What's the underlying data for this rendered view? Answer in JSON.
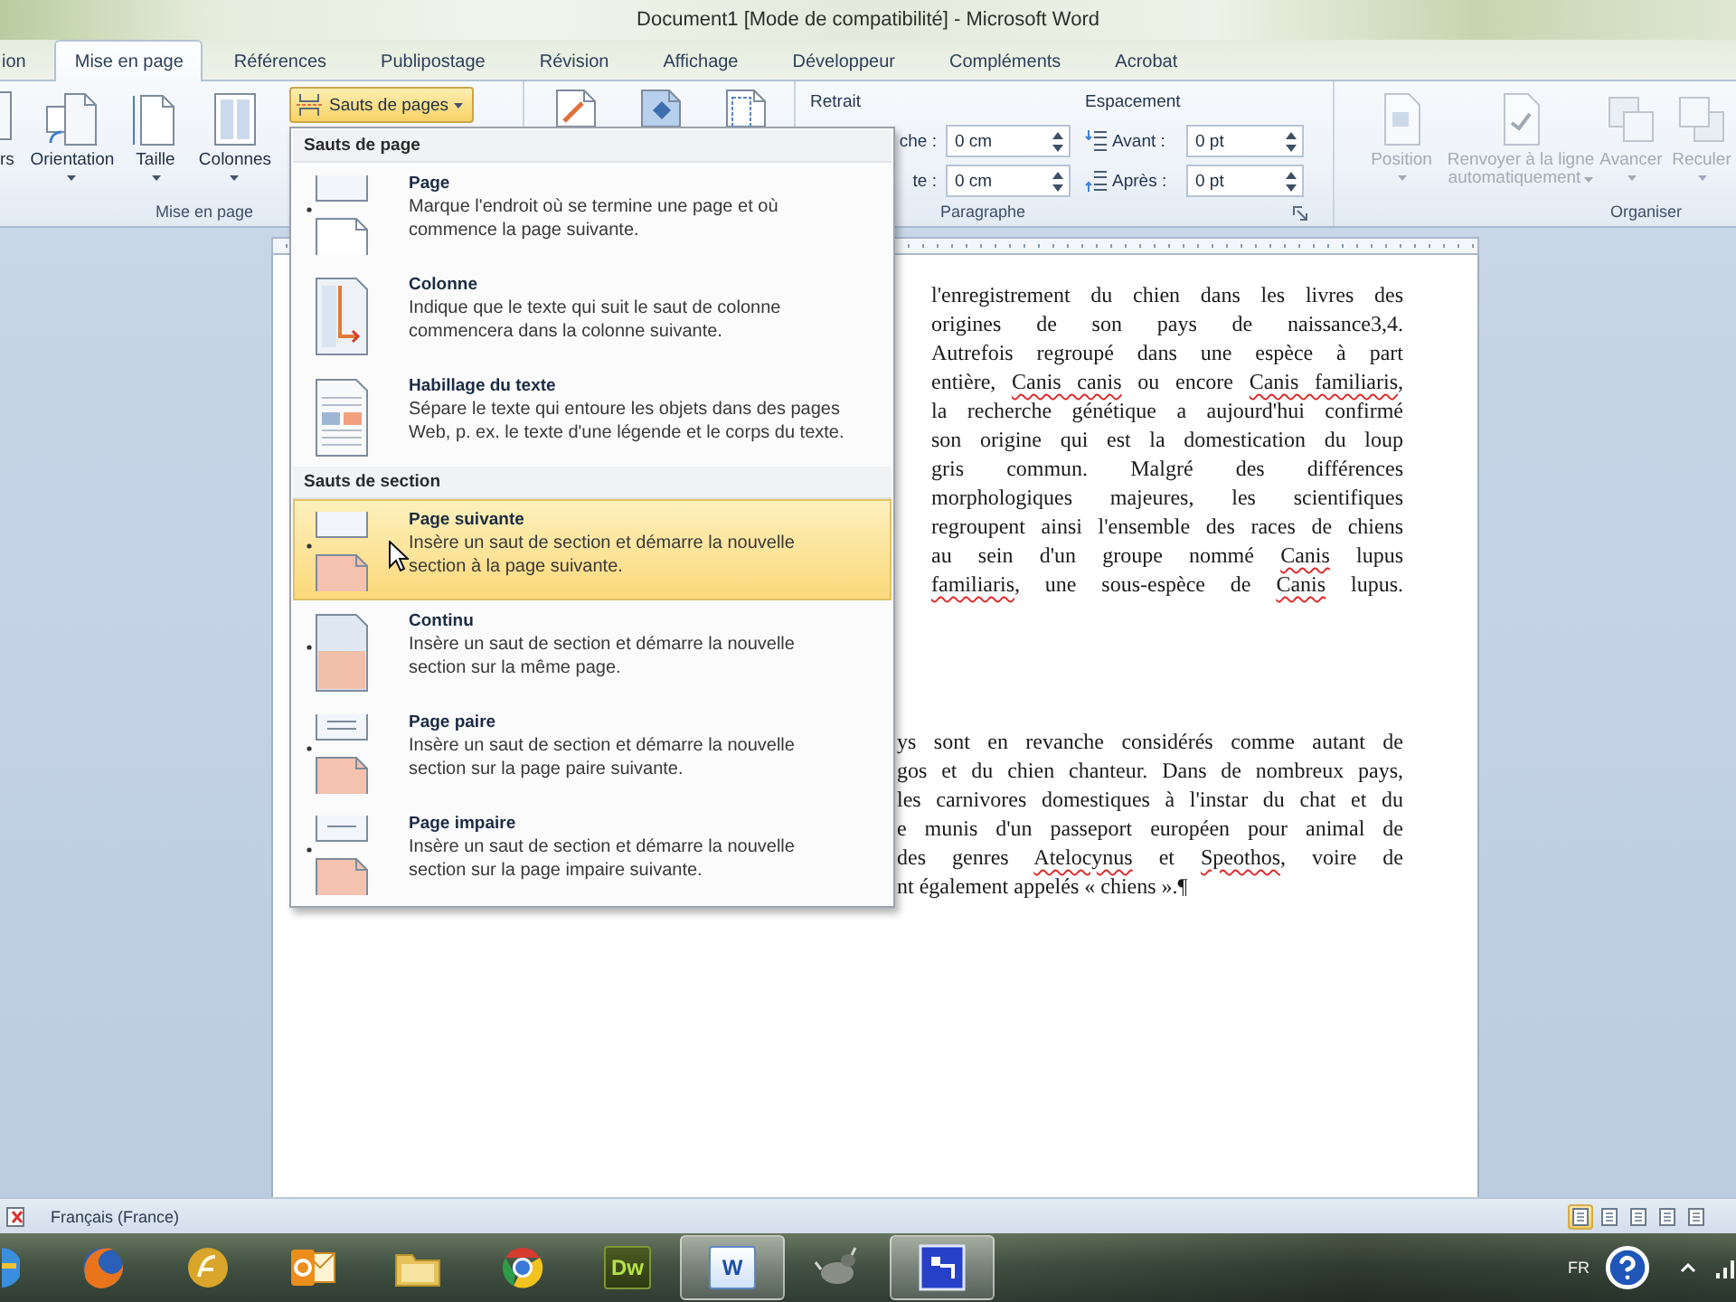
{
  "window": {
    "title": "Document1 [Mode de compatibilité] - Microsoft Word"
  },
  "tabs": [
    {
      "label": "ion",
      "selected": false
    },
    {
      "label": "Mise en page",
      "selected": true
    },
    {
      "label": "Références",
      "selected": false
    },
    {
      "label": "Publipostage",
      "selected": false
    },
    {
      "label": "Révision",
      "selected": false
    },
    {
      "label": "Affichage",
      "selected": false
    },
    {
      "label": "Développeur",
      "selected": false
    },
    {
      "label": "Compléments",
      "selected": false
    },
    {
      "label": "Acrobat",
      "selected": false
    }
  ],
  "ribbon": {
    "page_setup": {
      "label": "Mise en page",
      "buttons": [
        {
          "kind": "margins",
          "label": "rs",
          "dropdown": false,
          "disabled": false
        },
        {
          "kind": "orientation",
          "label": "Orientation",
          "dropdown": true,
          "disabled": false
        },
        {
          "kind": "size",
          "label": "Taille",
          "dropdown": true,
          "disabled": false
        },
        {
          "kind": "columns",
          "label": "Colonnes",
          "dropdown": true,
          "disabled": false
        }
      ],
      "breaks_button": {
        "label": "Sauts de pages",
        "expanded": true
      }
    },
    "page_background": {
      "buttons": [
        {
          "kind": "watermark"
        },
        {
          "kind": "page-color"
        },
        {
          "kind": "page-borders"
        }
      ]
    },
    "paragraph": {
      "label": "Paragraphe",
      "indent": {
        "title": "Retrait",
        "fields": [
          {
            "label": "che :",
            "value": "0 cm"
          },
          {
            "label": "te :",
            "value": "0 cm"
          }
        ]
      },
      "spacing": {
        "title": "Espacement",
        "fields": [
          {
            "kind": "before",
            "label": "Avant :",
            "value": "0 pt"
          },
          {
            "kind": "after",
            "label": "Après :",
            "value": "0 pt"
          }
        ]
      }
    },
    "arrange": {
      "label": "Organiser",
      "buttons": [
        {
          "kind": "position",
          "label": "Position",
          "dropdown": true,
          "disabled": true
        },
        {
          "kind": "wrap-text",
          "label": "Renvoyer à la ligne\nautomatiquement",
          "dropdown": true,
          "disabled": true
        },
        {
          "kind": "bring-forward",
          "label": "Avancer",
          "dropdown": true,
          "disabled": true
        },
        {
          "kind": "send-backward",
          "label": "Reculer",
          "dropdown": true,
          "disabled": true
        }
      ]
    }
  },
  "breaks_menu": {
    "sections": [
      {
        "title": "Sauts de page",
        "items": [
          {
            "kind": "page",
            "title": "Page",
            "description": "Marque l'endroit où se termine une page et où\ncommence la page suivante.",
            "highlighted": false
          },
          {
            "kind": "column",
            "title": "Colonne",
            "description": "Indique que le texte qui suit le saut de colonne\ncommencera dans la colonne suivante.",
            "highlighted": false
          },
          {
            "kind": "wrap",
            "title": "Habillage du texte",
            "description": "Sépare le texte qui entoure les objets dans des pages\nWeb, p. ex. le texte d'une légende et le corps du texte.",
            "highlighted": false
          }
        ]
      },
      {
        "title": "Sauts de section",
        "items": [
          {
            "kind": "next",
            "title": "Page suivante",
            "description": "Insère un saut de section et démarre la nouvelle\nsection à la page suivante.",
            "highlighted": true
          },
          {
            "kind": "continuous",
            "title": "Continu",
            "description": "Insère un saut de section et démarre la nouvelle\nsection sur la même page.",
            "highlighted": false
          },
          {
            "kind": "even",
            "title": "Page paire",
            "description": "Insère un saut de section et démarre la nouvelle\nsection sur la page paire suivante.",
            "highlighted": false
          },
          {
            "kind": "odd",
            "title": "Page impaire",
            "description": "Insère un saut de section et démarre la nouvelle\nsection sur la page impaire suivante.",
            "highlighted": false
          }
        ]
      }
    ]
  },
  "document": {
    "paragraphs": [
      {
        "last_line_justified": true,
        "lines": [
          [
            {
              "text": "l'enregistrement du chien dans les livres des",
              "misspelled": false
            }
          ],
          [
            {
              "text": "origines de son pays de naissance3,4.",
              "misspelled": false
            }
          ],
          [
            {
              "text": "Autrefois regroupé dans une espèce à part",
              "misspelled": false
            }
          ],
          [
            {
              "text": "entière, ",
              "misspelled": false
            },
            {
              "text": "Canis canis",
              "misspelled": true
            },
            {
              "text": " ou encore ",
              "misspelled": false
            },
            {
              "text": "Canis familiaris",
              "misspelled": true
            },
            {
              "text": ",",
              "misspelled": false
            }
          ],
          [
            {
              "text": "la recherche génétique a aujourd'hui confirmé",
              "misspelled": false
            }
          ],
          [
            {
              "text": "son origine qui est la domestication du loup",
              "misspelled": false
            }
          ],
          [
            {
              "text": "gris commun. Malgré des différences",
              "misspelled": false
            }
          ],
          [
            {
              "text": "morphologiques majeures, les scientifiques",
              "misspelled": false
            }
          ],
          [
            {
              "text": "regroupent ainsi l'ensemble des races de chiens",
              "misspelled": false
            }
          ],
          [
            {
              "text": "au sein d'un groupe nommé ",
              "misspelled": false
            },
            {
              "text": "Canis",
              "misspelled": true
            },
            {
              "text": " lupus",
              "misspelled": false
            }
          ],
          [
            {
              "text": "familiaris",
              "misspelled": true
            },
            {
              "text": ", une sous-espèce de ",
              "misspelled": false
            },
            {
              "text": "Canis",
              "misspelled": true
            },
            {
              "text": " lupus.",
              "misspelled": false
            }
          ]
        ]
      },
      {
        "last_line_justified": false,
        "lines": [
          [
            {
              "text": "ys sont en revanche considérés comme autant de",
              "misspelled": false
            }
          ],
          [
            {
              "text": "gos et du chien chanteur. Dans de nombreux pays,",
              "misspelled": false
            }
          ],
          [
            {
              "text": "les carnivores domestiques à l'instar du chat et du",
              "misspelled": false
            }
          ],
          [
            {
              "text": "e munis d'un passeport européen pour animal de",
              "misspelled": false
            }
          ],
          [
            {
              "text": "des genres ",
              "misspelled": false
            },
            {
              "text": "Atelocynus",
              "misspelled": true
            },
            {
              "text": " et ",
              "misspelled": false
            },
            {
              "text": "Speothos",
              "misspelled": true
            },
            {
              "text": ", voire de",
              "misspelled": false
            }
          ],
          [
            {
              "text": "nt également appelés « chiens ».¶",
              "misspelled": false
            }
          ]
        ]
      }
    ]
  },
  "status_bar": {
    "language": "Français (France)",
    "views": [
      {
        "selected": true
      },
      {
        "selected": false
      },
      {
        "selected": false
      },
      {
        "selected": false
      },
      {
        "selected": false
      }
    ]
  },
  "taskbar": {
    "apps": [
      {
        "kind": "blue-e",
        "active": false
      },
      {
        "kind": "fox-globe",
        "active": false
      },
      {
        "kind": "swirl",
        "active": false
      },
      {
        "kind": "mail",
        "active": false
      },
      {
        "kind": "folder",
        "active": false
      },
      {
        "kind": "tri-ring",
        "active": false
      },
      {
        "kind": "tile",
        "glyph": "Dw",
        "active": false
      },
      {
        "kind": "doc-tile",
        "glyph": "W",
        "active": true
      },
      {
        "kind": "animal",
        "active": false
      },
      {
        "kind": "blue-window",
        "active": true
      }
    ],
    "language": "FR"
  }
}
